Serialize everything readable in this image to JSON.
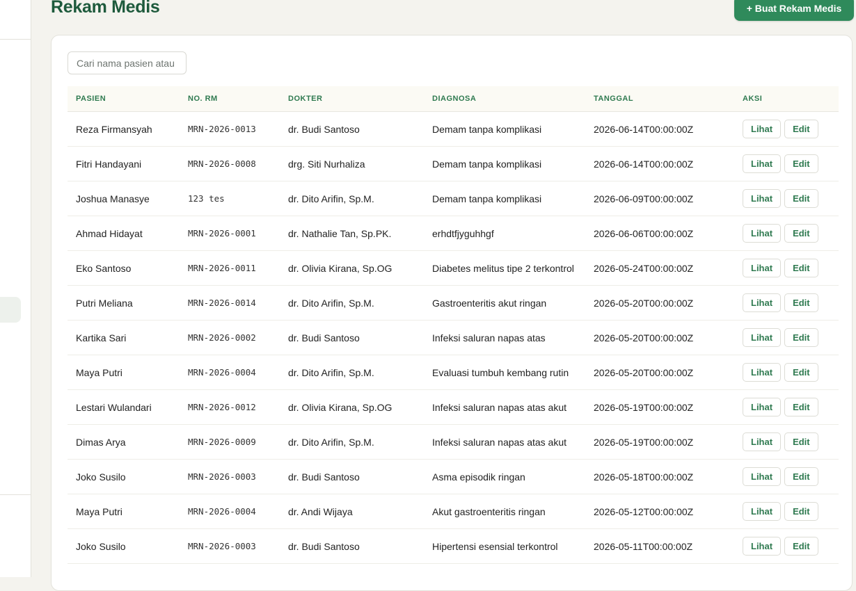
{
  "header": {
    "title": "Rekam Medis",
    "create_button": "+ Buat Rekam Medis"
  },
  "search": {
    "placeholder": "Cari nama pasien atau no. RM"
  },
  "table": {
    "columns": [
      "PASIEN",
      "NO. RM",
      "DOKTER",
      "DIAGNOSA",
      "TANGGAL",
      "AKSI"
    ],
    "view_label": "Lihat",
    "edit_label": "Edit",
    "rows": [
      {
        "pasien": "Reza Firmansyah",
        "no_rm": "MRN-2026-0013",
        "dokter": "dr. Budi Santoso",
        "diagnosa": "Demam tanpa komplikasi",
        "tanggal": "2026-06-14T00:00:00Z"
      },
      {
        "pasien": "Fitri Handayani",
        "no_rm": "MRN-2026-0008",
        "dokter": "drg. Siti Nurhaliza",
        "diagnosa": "Demam tanpa komplikasi",
        "tanggal": "2026-06-14T00:00:00Z"
      },
      {
        "pasien": "Joshua Manasye",
        "no_rm": "123 tes",
        "dokter": "dr. Dito Arifin, Sp.M.",
        "diagnosa": "Demam tanpa komplikasi",
        "tanggal": "2026-06-09T00:00:00Z"
      },
      {
        "pasien": "Ahmad Hidayat",
        "no_rm": "MRN-2026-0001",
        "dokter": "dr. Nathalie Tan, Sp.PK.",
        "diagnosa": "erhdtfjyguhhgf",
        "tanggal": "2026-06-06T00:00:00Z"
      },
      {
        "pasien": "Eko Santoso",
        "no_rm": "MRN-2026-0011",
        "dokter": "dr. Olivia Kirana, Sp.OG",
        "diagnosa": "Diabetes melitus tipe 2 terkontrol",
        "tanggal": "2026-05-24T00:00:00Z"
      },
      {
        "pasien": "Putri Meliana",
        "no_rm": "MRN-2026-0014",
        "dokter": "dr. Dito Arifin, Sp.M.",
        "diagnosa": "Gastroenteritis akut ringan",
        "tanggal": "2026-05-20T00:00:00Z"
      },
      {
        "pasien": "Kartika Sari",
        "no_rm": "MRN-2026-0002",
        "dokter": "dr. Budi Santoso",
        "diagnosa": "Infeksi saluran napas atas",
        "tanggal": "2026-05-20T00:00:00Z"
      },
      {
        "pasien": "Maya Putri",
        "no_rm": "MRN-2026-0004",
        "dokter": "dr. Dito Arifin, Sp.M.",
        "diagnosa": "Evaluasi tumbuh kembang rutin",
        "tanggal": "2026-05-20T00:00:00Z"
      },
      {
        "pasien": "Lestari Wulandari",
        "no_rm": "MRN-2026-0012",
        "dokter": "dr. Olivia Kirana, Sp.OG",
        "diagnosa": "Infeksi saluran napas atas akut",
        "tanggal": "2026-05-19T00:00:00Z"
      },
      {
        "pasien": "Dimas Arya",
        "no_rm": "MRN-2026-0009",
        "dokter": "dr. Dito Arifin, Sp.M.",
        "diagnosa": "Infeksi saluran napas atas akut",
        "tanggal": "2026-05-19T00:00:00Z"
      },
      {
        "pasien": "Joko Susilo",
        "no_rm": "MRN-2026-0003",
        "dokter": "dr. Budi Santoso",
        "diagnosa": "Asma episodik ringan",
        "tanggal": "2026-05-18T00:00:00Z"
      },
      {
        "pasien": "Maya Putri",
        "no_rm": "MRN-2026-0004",
        "dokter": "dr. Andi Wijaya",
        "diagnosa": "Akut gastroenteritis ringan",
        "tanggal": "2026-05-12T00:00:00Z"
      },
      {
        "pasien": "Joko Susilo",
        "no_rm": "MRN-2026-0003",
        "dokter": "dr. Budi Santoso",
        "diagnosa": "Hipertensi esensial terkontrol",
        "tanggal": "2026-05-11T00:00:00Z"
      }
    ]
  },
  "colors": {
    "accent": "#2f8a5b",
    "title": "#1e5a3c",
    "header_text": "#2f7a50",
    "background": "#f4f3ee"
  }
}
